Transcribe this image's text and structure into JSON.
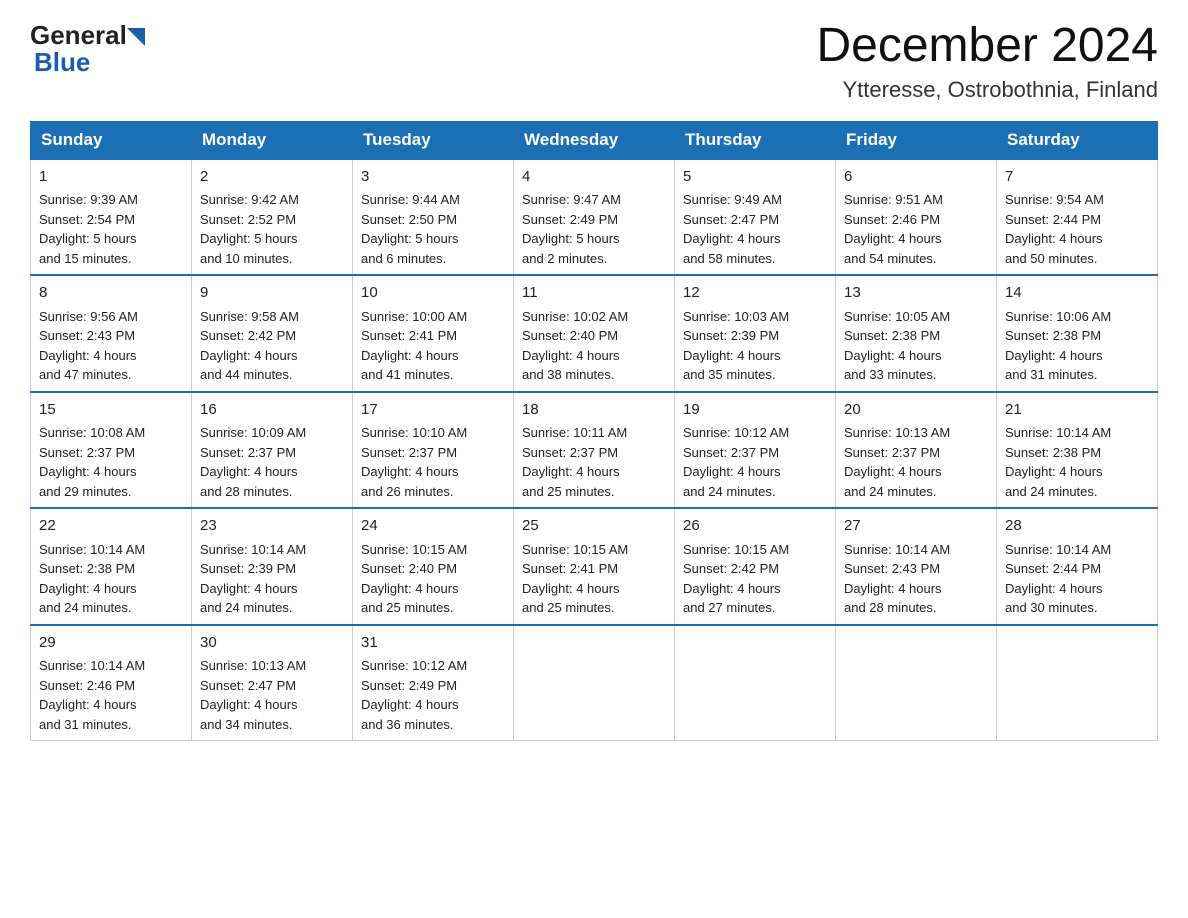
{
  "header": {
    "logo": {
      "general": "General",
      "blue": "Blue"
    },
    "title": "December 2024",
    "location": "Ytteresse, Ostrobothnia, Finland"
  },
  "days_of_week": [
    "Sunday",
    "Monday",
    "Tuesday",
    "Wednesday",
    "Thursday",
    "Friday",
    "Saturday"
  ],
  "weeks": [
    [
      {
        "day": "1",
        "sunrise": "Sunrise: 9:39 AM",
        "sunset": "Sunset: 2:54 PM",
        "daylight": "Daylight: 5 hours",
        "daylight2": "and 15 minutes."
      },
      {
        "day": "2",
        "sunrise": "Sunrise: 9:42 AM",
        "sunset": "Sunset: 2:52 PM",
        "daylight": "Daylight: 5 hours",
        "daylight2": "and 10 minutes."
      },
      {
        "day": "3",
        "sunrise": "Sunrise: 9:44 AM",
        "sunset": "Sunset: 2:50 PM",
        "daylight": "Daylight: 5 hours",
        "daylight2": "and 6 minutes."
      },
      {
        "day": "4",
        "sunrise": "Sunrise: 9:47 AM",
        "sunset": "Sunset: 2:49 PM",
        "daylight": "Daylight: 5 hours",
        "daylight2": "and 2 minutes."
      },
      {
        "day": "5",
        "sunrise": "Sunrise: 9:49 AM",
        "sunset": "Sunset: 2:47 PM",
        "daylight": "Daylight: 4 hours",
        "daylight2": "and 58 minutes."
      },
      {
        "day": "6",
        "sunrise": "Sunrise: 9:51 AM",
        "sunset": "Sunset: 2:46 PM",
        "daylight": "Daylight: 4 hours",
        "daylight2": "and 54 minutes."
      },
      {
        "day": "7",
        "sunrise": "Sunrise: 9:54 AM",
        "sunset": "Sunset: 2:44 PM",
        "daylight": "Daylight: 4 hours",
        "daylight2": "and 50 minutes."
      }
    ],
    [
      {
        "day": "8",
        "sunrise": "Sunrise: 9:56 AM",
        "sunset": "Sunset: 2:43 PM",
        "daylight": "Daylight: 4 hours",
        "daylight2": "and 47 minutes."
      },
      {
        "day": "9",
        "sunrise": "Sunrise: 9:58 AM",
        "sunset": "Sunset: 2:42 PM",
        "daylight": "Daylight: 4 hours",
        "daylight2": "and 44 minutes."
      },
      {
        "day": "10",
        "sunrise": "Sunrise: 10:00 AM",
        "sunset": "Sunset: 2:41 PM",
        "daylight": "Daylight: 4 hours",
        "daylight2": "and 41 minutes."
      },
      {
        "day": "11",
        "sunrise": "Sunrise: 10:02 AM",
        "sunset": "Sunset: 2:40 PM",
        "daylight": "Daylight: 4 hours",
        "daylight2": "and 38 minutes."
      },
      {
        "day": "12",
        "sunrise": "Sunrise: 10:03 AM",
        "sunset": "Sunset: 2:39 PM",
        "daylight": "Daylight: 4 hours",
        "daylight2": "and 35 minutes."
      },
      {
        "day": "13",
        "sunrise": "Sunrise: 10:05 AM",
        "sunset": "Sunset: 2:38 PM",
        "daylight": "Daylight: 4 hours",
        "daylight2": "and 33 minutes."
      },
      {
        "day": "14",
        "sunrise": "Sunrise: 10:06 AM",
        "sunset": "Sunset: 2:38 PM",
        "daylight": "Daylight: 4 hours",
        "daylight2": "and 31 minutes."
      }
    ],
    [
      {
        "day": "15",
        "sunrise": "Sunrise: 10:08 AM",
        "sunset": "Sunset: 2:37 PM",
        "daylight": "Daylight: 4 hours",
        "daylight2": "and 29 minutes."
      },
      {
        "day": "16",
        "sunrise": "Sunrise: 10:09 AM",
        "sunset": "Sunset: 2:37 PM",
        "daylight": "Daylight: 4 hours",
        "daylight2": "and 28 minutes."
      },
      {
        "day": "17",
        "sunrise": "Sunrise: 10:10 AM",
        "sunset": "Sunset: 2:37 PM",
        "daylight": "Daylight: 4 hours",
        "daylight2": "and 26 minutes."
      },
      {
        "day": "18",
        "sunrise": "Sunrise: 10:11 AM",
        "sunset": "Sunset: 2:37 PM",
        "daylight": "Daylight: 4 hours",
        "daylight2": "and 25 minutes."
      },
      {
        "day": "19",
        "sunrise": "Sunrise: 10:12 AM",
        "sunset": "Sunset: 2:37 PM",
        "daylight": "Daylight: 4 hours",
        "daylight2": "and 24 minutes."
      },
      {
        "day": "20",
        "sunrise": "Sunrise: 10:13 AM",
        "sunset": "Sunset: 2:37 PM",
        "daylight": "Daylight: 4 hours",
        "daylight2": "and 24 minutes."
      },
      {
        "day": "21",
        "sunrise": "Sunrise: 10:14 AM",
        "sunset": "Sunset: 2:38 PM",
        "daylight": "Daylight: 4 hours",
        "daylight2": "and 24 minutes."
      }
    ],
    [
      {
        "day": "22",
        "sunrise": "Sunrise: 10:14 AM",
        "sunset": "Sunset: 2:38 PM",
        "daylight": "Daylight: 4 hours",
        "daylight2": "and 24 minutes."
      },
      {
        "day": "23",
        "sunrise": "Sunrise: 10:14 AM",
        "sunset": "Sunset: 2:39 PM",
        "daylight": "Daylight: 4 hours",
        "daylight2": "and 24 minutes."
      },
      {
        "day": "24",
        "sunrise": "Sunrise: 10:15 AM",
        "sunset": "Sunset: 2:40 PM",
        "daylight": "Daylight: 4 hours",
        "daylight2": "and 25 minutes."
      },
      {
        "day": "25",
        "sunrise": "Sunrise: 10:15 AM",
        "sunset": "Sunset: 2:41 PM",
        "daylight": "Daylight: 4 hours",
        "daylight2": "and 25 minutes."
      },
      {
        "day": "26",
        "sunrise": "Sunrise: 10:15 AM",
        "sunset": "Sunset: 2:42 PM",
        "daylight": "Daylight: 4 hours",
        "daylight2": "and 27 minutes."
      },
      {
        "day": "27",
        "sunrise": "Sunrise: 10:14 AM",
        "sunset": "Sunset: 2:43 PM",
        "daylight": "Daylight: 4 hours",
        "daylight2": "and 28 minutes."
      },
      {
        "day": "28",
        "sunrise": "Sunrise: 10:14 AM",
        "sunset": "Sunset: 2:44 PM",
        "daylight": "Daylight: 4 hours",
        "daylight2": "and 30 minutes."
      }
    ],
    [
      {
        "day": "29",
        "sunrise": "Sunrise: 10:14 AM",
        "sunset": "Sunset: 2:46 PM",
        "daylight": "Daylight: 4 hours",
        "daylight2": "and 31 minutes."
      },
      {
        "day": "30",
        "sunrise": "Sunrise: 10:13 AM",
        "sunset": "Sunset: 2:47 PM",
        "daylight": "Daylight: 4 hours",
        "daylight2": "and 34 minutes."
      },
      {
        "day": "31",
        "sunrise": "Sunrise: 10:12 AM",
        "sunset": "Sunset: 2:49 PM",
        "daylight": "Daylight: 4 hours",
        "daylight2": "and 36 minutes."
      },
      null,
      null,
      null,
      null
    ]
  ]
}
